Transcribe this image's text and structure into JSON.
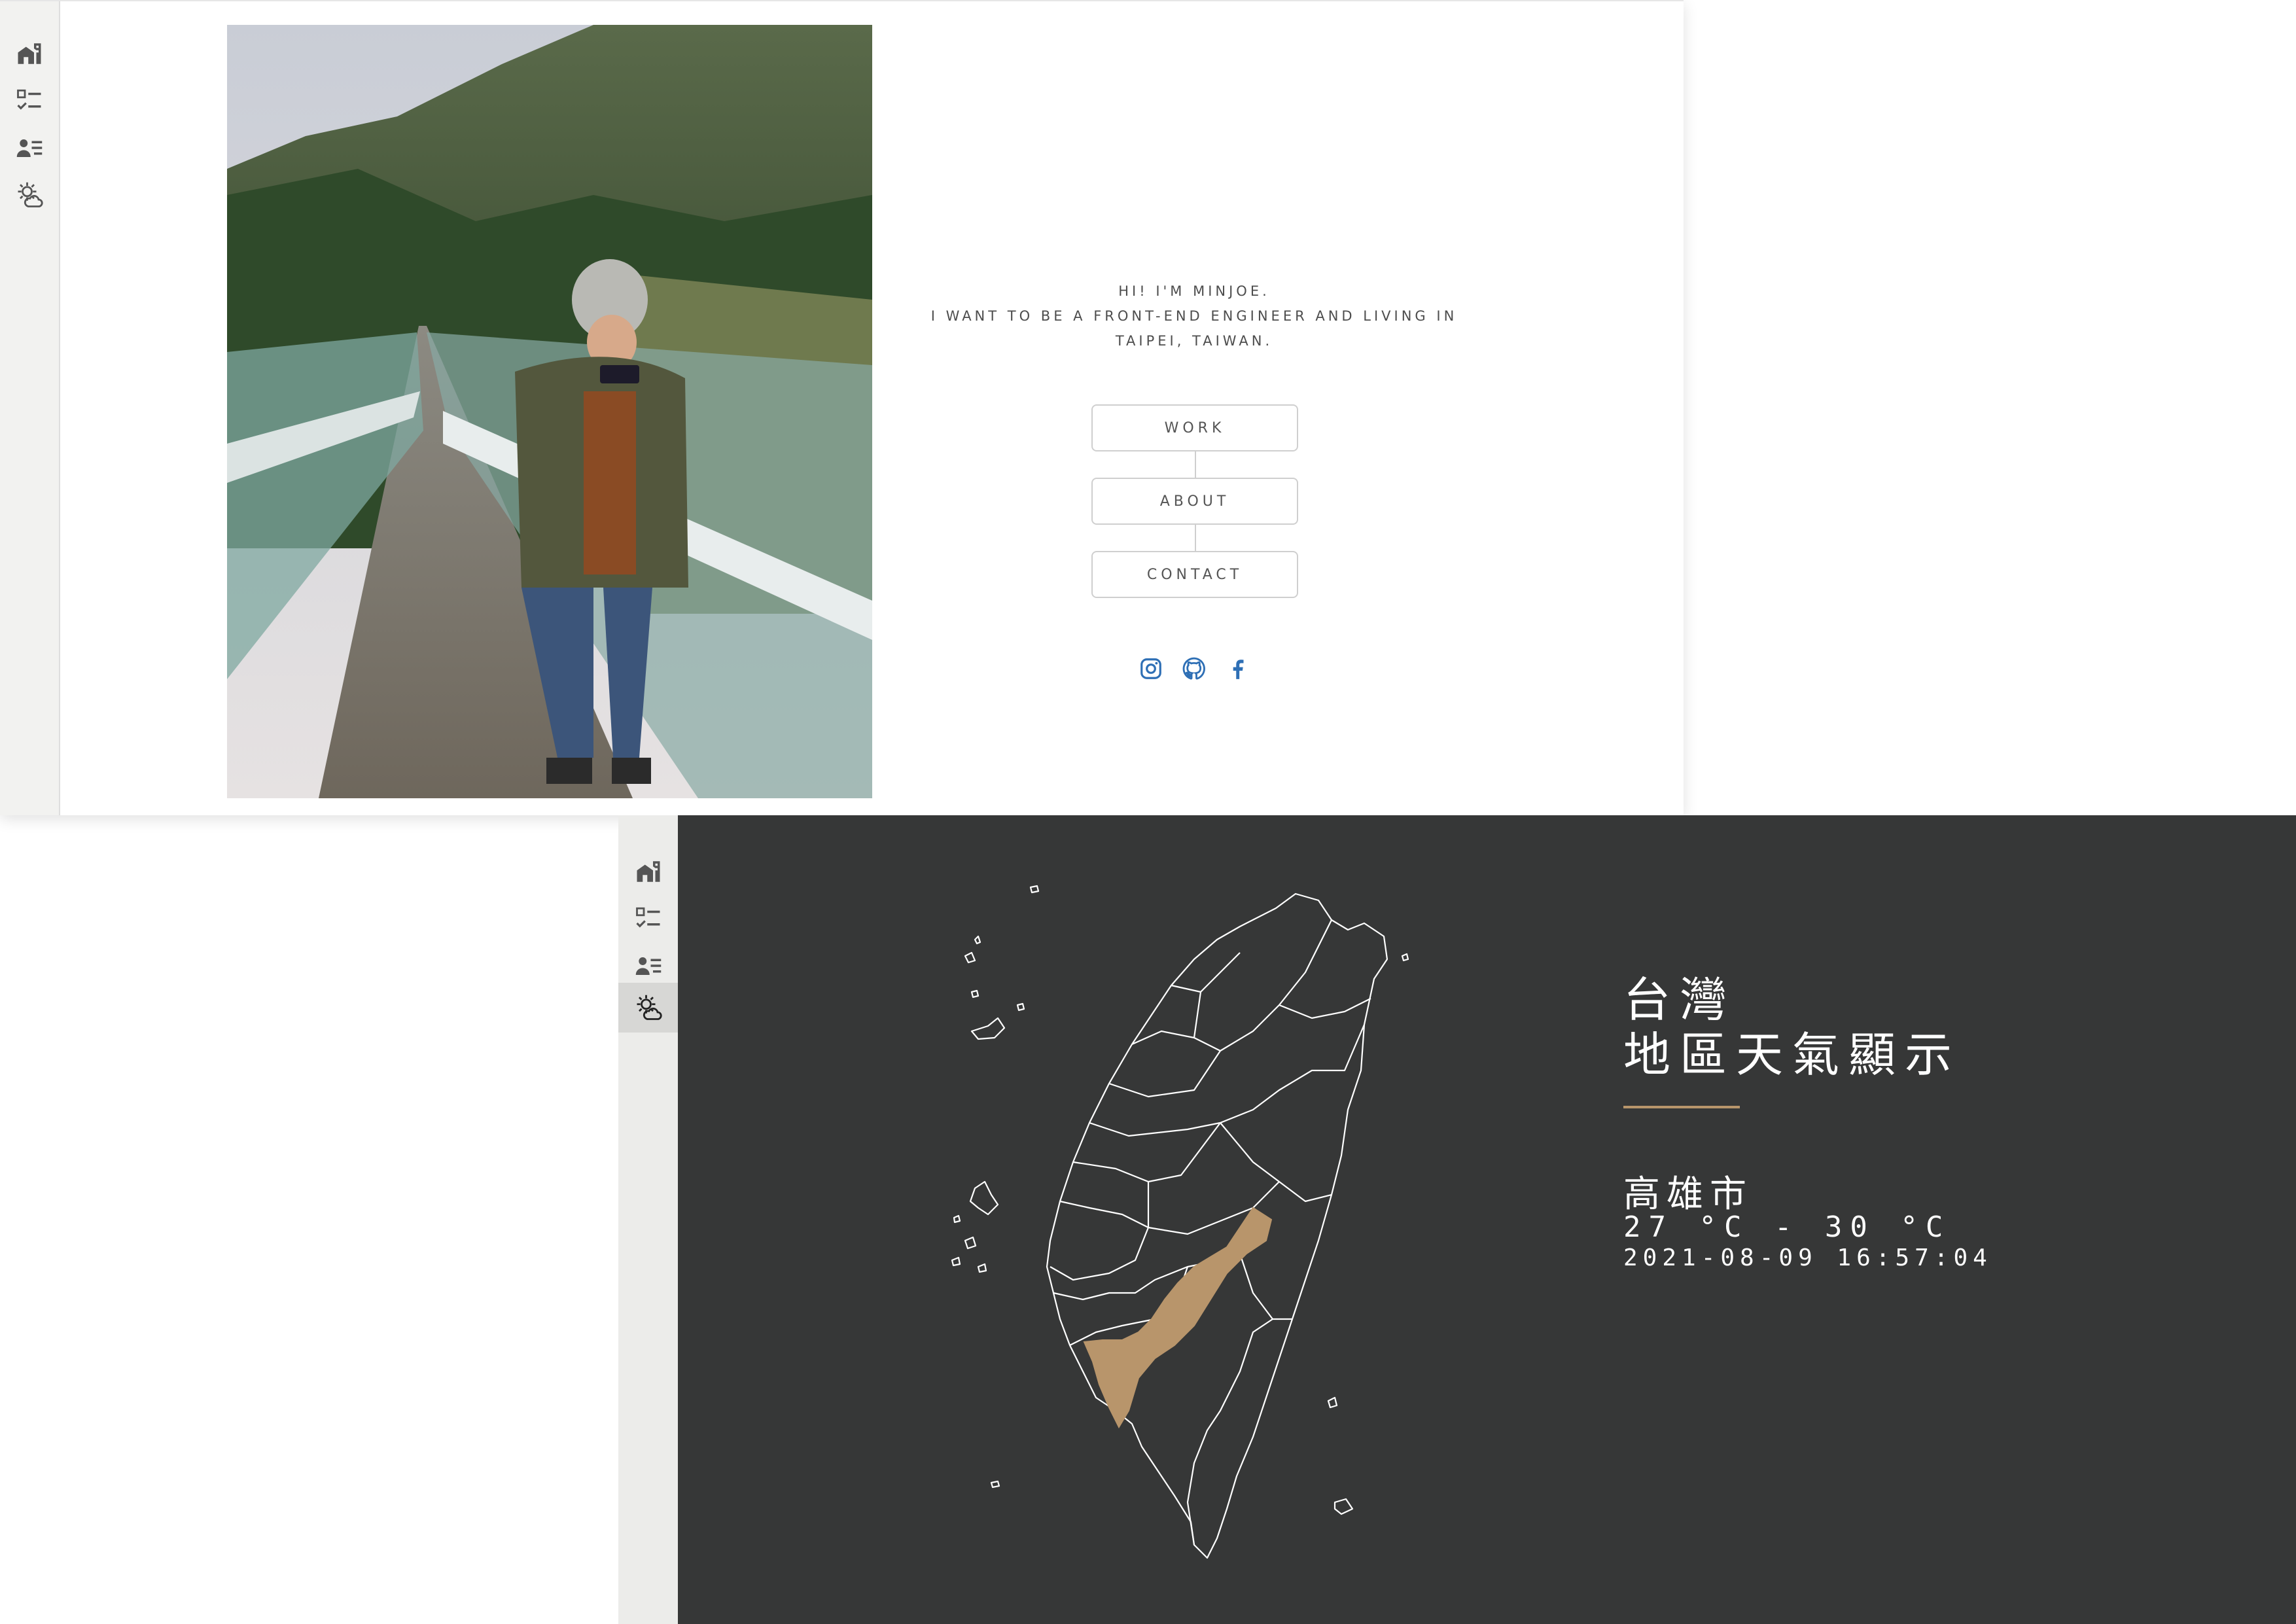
{
  "colors": {
    "accent": "#b8956b",
    "weather_bg": "#363737",
    "social_blue": "#2e6fb5",
    "icon_gray": "#555555"
  },
  "sidebar_icons": [
    "home-icon",
    "checklist-icon",
    "contact-list-icon",
    "weather-icon"
  ],
  "portfolio": {
    "intro_lines": [
      "HI! I'M MINJOE.",
      "I WANT TO BE A FRONT-END ENGINEER AND LIVING IN",
      "TAIPEI, TAIWAN."
    ],
    "menu": [
      {
        "label": "WORK"
      },
      {
        "label": "ABOUT"
      },
      {
        "label": "CONTACT"
      }
    ],
    "social_icons": [
      "instagram-icon",
      "github-icon",
      "facebook-icon"
    ]
  },
  "weather": {
    "title_line1": "台灣",
    "title_line2": "地區天氣顯示",
    "city": "高雄市",
    "temperature": "27 °C - 30 °C",
    "datetime": "2021-08-09 16:57:04",
    "highlighted_region": "高雄市"
  }
}
